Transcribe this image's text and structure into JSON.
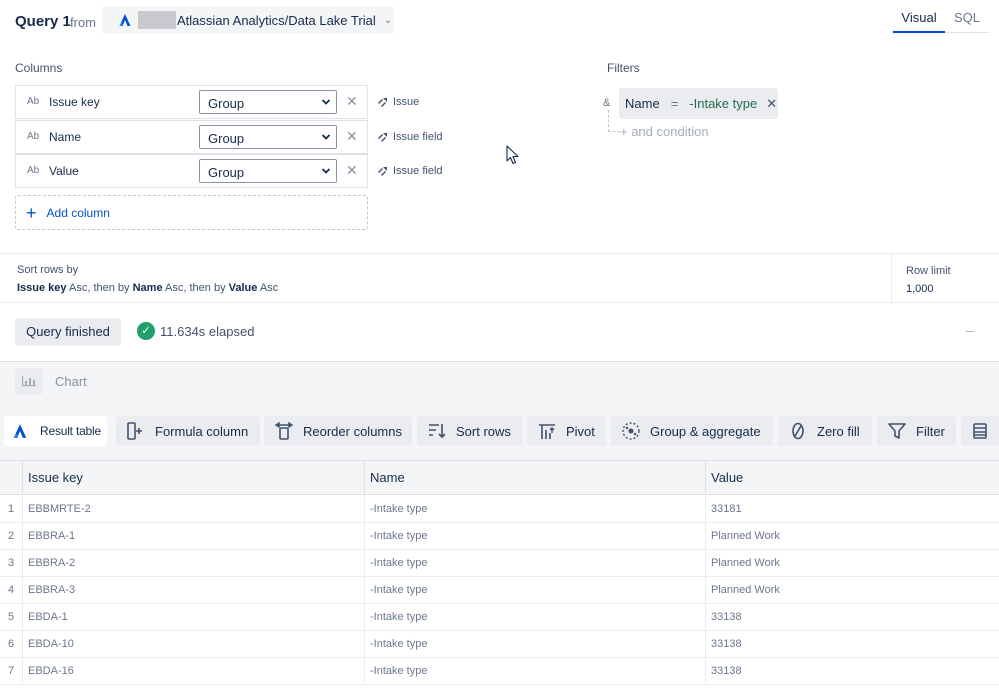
{
  "header": {
    "title": "Query 1",
    "from_label": "from",
    "source_name": "Atlassian Analytics/Data Lake Trial",
    "mode_tabs": [
      "Visual",
      "SQL"
    ],
    "active_tab": "Visual"
  },
  "columns_section": {
    "label": "Columns",
    "items": [
      {
        "type": "Ab",
        "name": "Issue key",
        "aggregation": "Group",
        "source": "Issue"
      },
      {
        "type": "Ab",
        "name": "Name",
        "aggregation": "Group",
        "source": "Issue field"
      },
      {
        "type": "Ab",
        "name": "Value",
        "aggregation": "Group",
        "source": "Issue field"
      }
    ],
    "add_label": "Add column"
  },
  "filters_section": {
    "label": "Filters",
    "connector": "&",
    "filter": {
      "field": "Name",
      "operator": "=",
      "value": "-Intake type"
    },
    "add_condition_label": "+ and condition"
  },
  "sort": {
    "label": "Sort rows by",
    "parts": [
      {
        "col": "Issue key",
        "dir": "Asc",
        "sep": ", then by "
      },
      {
        "col": "Name",
        "dir": "Asc",
        "sep": ", then by "
      },
      {
        "col": "Value",
        "dir": "Asc",
        "sep": ""
      }
    ]
  },
  "row_limit": {
    "label": "Row limit",
    "value": "1,000"
  },
  "status": {
    "label": "Query finished",
    "elapsed": "11.634s elapsed"
  },
  "chart": {
    "label": "Chart"
  },
  "toolbar": {
    "result_table": "Result table",
    "formula_column": "Formula column",
    "reorder_columns": "Reorder columns",
    "sort_rows": "Sort rows",
    "pivot": "Pivot",
    "group_aggregate": "Group & aggregate",
    "zero_fill": "Zero fill",
    "filter": "Filter"
  },
  "table": {
    "headers": [
      "Issue key",
      "Name",
      "Value"
    ],
    "rows": [
      [
        "1",
        "EBBMRTE-2",
        "-Intake type",
        "33181"
      ],
      [
        "2",
        "EBBRA-1",
        "-Intake type",
        "Planned Work"
      ],
      [
        "3",
        "EBBRA-2",
        "-Intake type",
        "Planned Work"
      ],
      [
        "4",
        "EBBRA-3",
        "-Intake type",
        "Planned Work"
      ],
      [
        "5",
        "EBDA-1",
        "-Intake type",
        "33138"
      ],
      [
        "6",
        "EBDA-10",
        "-Intake type",
        "33138"
      ],
      [
        "7",
        "EBDA-16",
        "-Intake type",
        "33138"
      ]
    ]
  },
  "colors": {
    "accent": "#0052cc",
    "success": "#22a06b",
    "filter_value": "#216e4e"
  },
  "icons": {
    "source": "atlassian-logo-icon",
    "column_source": "jira-field-icon",
    "remove": "close-icon",
    "chevron": "chevron-down-icon"
  }
}
